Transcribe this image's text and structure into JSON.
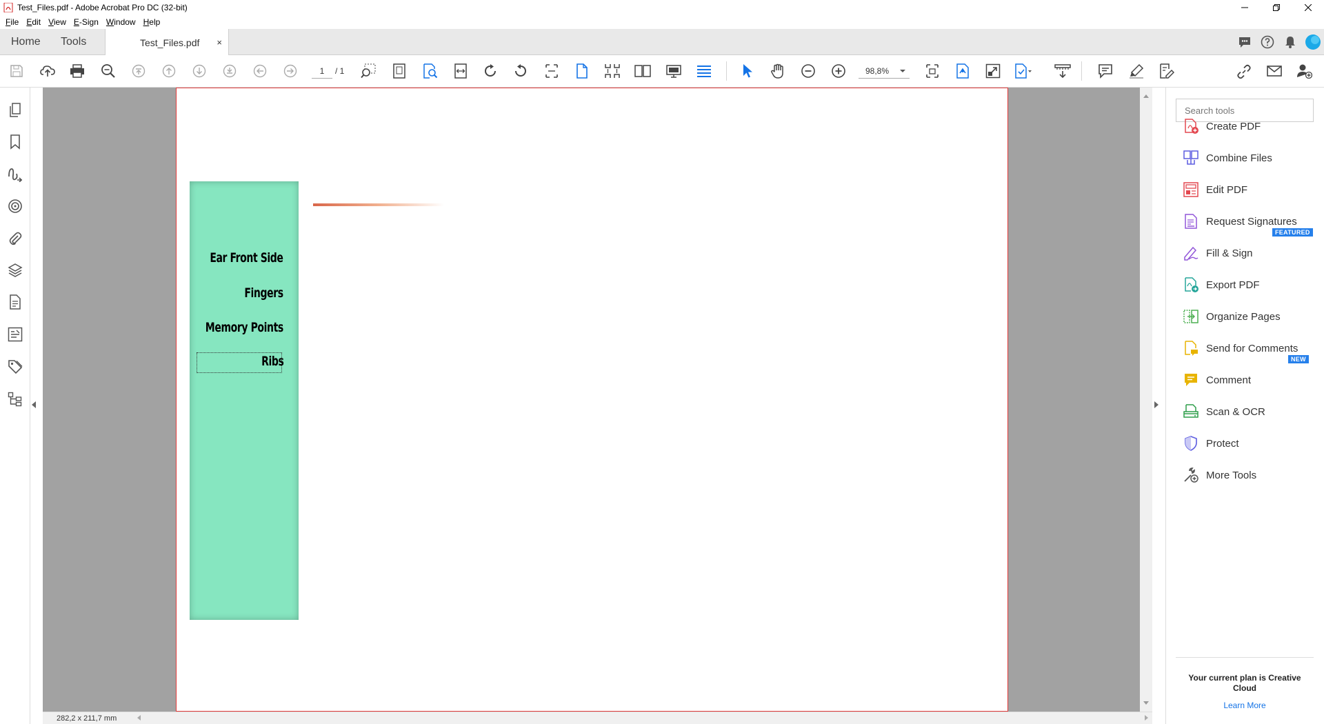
{
  "window": {
    "title": "Test_Files.pdf - Adobe Acrobat Pro DC (32-bit)"
  },
  "menu": [
    "File",
    "Edit",
    "View",
    "E-Sign",
    "Window",
    "Help"
  ],
  "tabs": {
    "home": "Home",
    "tools": "Tools",
    "document": "Test_Files.pdf",
    "close": "×"
  },
  "toolbar": {
    "page_current": "1",
    "page_total": "/ 1",
    "zoom": "98,8%"
  },
  "document": {
    "menu_items": [
      "Ear Front Side",
      "Fingers",
      "Memory Points",
      "Ribs"
    ]
  },
  "status": {
    "page_size": "282,2 x 211,7 mm"
  },
  "right_panel": {
    "search_placeholder": "Search tools",
    "tools": [
      {
        "label": "Create PDF",
        "color": "#e34850"
      },
      {
        "label": "Combine Files",
        "color": "#5c5ce0"
      },
      {
        "label": "Edit PDF",
        "color": "#e34850"
      },
      {
        "label": "Request Signatures",
        "color": "#9256d9",
        "badge": "FEATURED"
      },
      {
        "label": "Fill & Sign",
        "color": "#9256d9"
      },
      {
        "label": "Export PDF",
        "color": "#26a69a"
      },
      {
        "label": "Organize Pages",
        "color": "#4caf50"
      },
      {
        "label": "Send for Comments",
        "color": "#e8b400",
        "badge": "NEW"
      },
      {
        "label": "Comment",
        "color": "#e8b400"
      },
      {
        "label": "Scan & OCR",
        "color": "#2e9e4a"
      },
      {
        "label": "Protect",
        "color": "#5c5ce0"
      },
      {
        "label": "More Tools",
        "color": "#555555"
      }
    ],
    "plan_text": "Your current plan is Creative Cloud",
    "learn_more": "Learn More"
  },
  "colors": {
    "accent": "#2680eb",
    "page_border": "#e03a3a",
    "green_panel": "#86e6c0"
  }
}
